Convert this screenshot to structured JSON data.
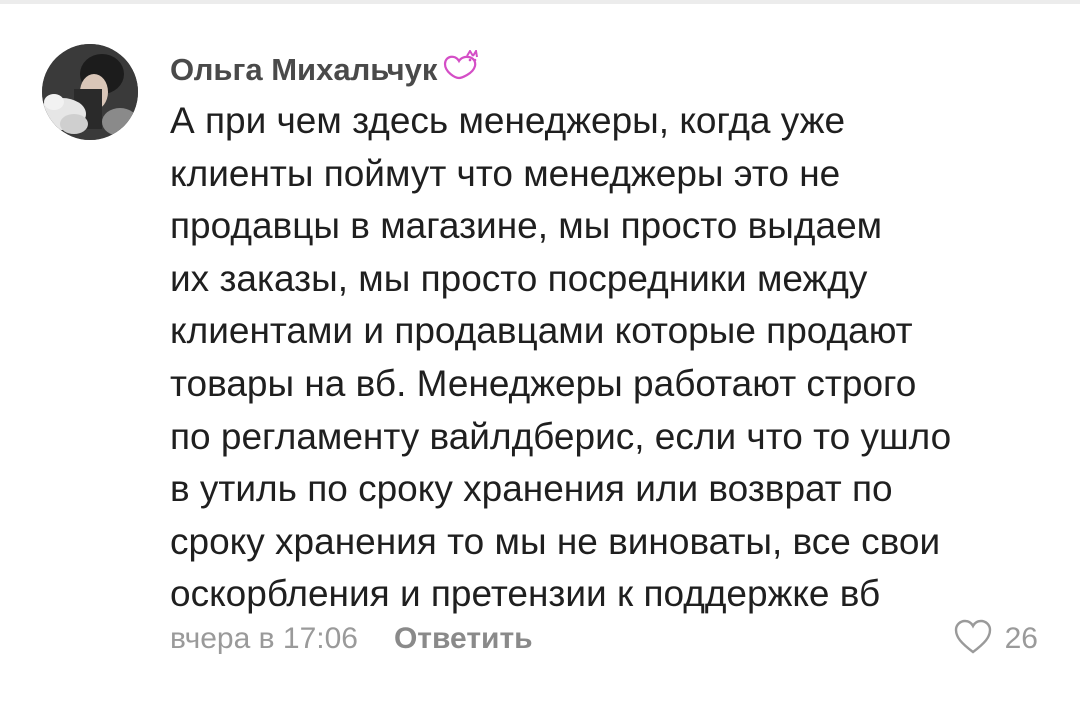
{
  "comment": {
    "author": "Ольга Михальчук",
    "badge_icon": "heart-cat-badge-icon",
    "badge_color": "#d44ec6",
    "text": "А при чем здесь менеджеры, когда уже клиенты поймут что менеджеры это не продавцы в магазине, мы просто выдаем их заказы, мы просто посредники между клиентами и продавцами которые продают товары на вб. Менеджеры работают строго по регламенту вайлдберис, если что то ушло в утиль по сроку хранения или возврат по сроку хранения то мы не виноваты, все свои оскорбления и претензии к поддержке вб",
    "lines": [
      "А при чем здесь менеджеры, когда уже",
      "клиенты поймут что менеджеры это не",
      "продавцы в магазине, мы просто выдаем",
      "их заказы, мы просто посредники между",
      "клиентами и продавцами которые продают",
      "товары на вб. Менеджеры работают строго",
      "по регламенту вайлдберис, если что то ушло",
      "в утиль по сроку хранения или возврат по",
      "сроку хранения то мы не виноваты, все свои",
      "оскорбления и претензии к поддержке вб"
    ],
    "time": "вчера в 17:06",
    "reply_label": "Ответить",
    "likes": "26",
    "like_icon": "heart-outline-icon"
  }
}
